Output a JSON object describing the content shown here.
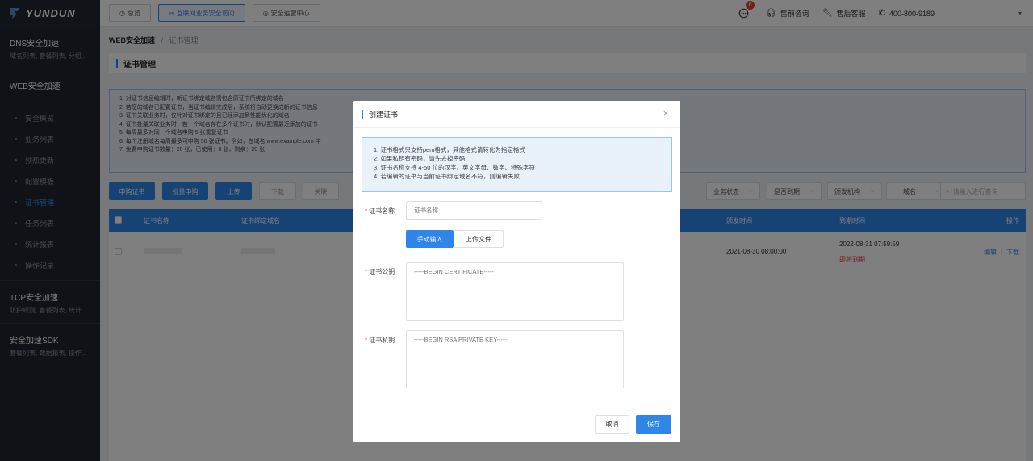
{
  "app": {
    "logo_text": "YUNDUN"
  },
  "topnav": {
    "tabs": [
      {
        "label": "总览"
      },
      {
        "label": "互联网业务安全访问"
      },
      {
        "label": "安全运营中心"
      }
    ],
    "notification_count": "6",
    "presales_label": "售前咨询",
    "aftersales_label": "售后客服",
    "phone": "400-800-9189"
  },
  "sidebar": {
    "groups": [
      {
        "title": "DNS安全加速",
        "subtitle": "域名列表, 套餐列表, 分组..."
      },
      {
        "title": "WEB安全加速"
      },
      {
        "title": "TCP安全加速",
        "subtitle": "防护规则, 套餐列表, 统计..."
      },
      {
        "title": "安全加速SDK",
        "subtitle": "套餐列表, 数据报表, 操作..."
      }
    ],
    "web_items": [
      {
        "label": "安全概览"
      },
      {
        "label": "业务列表"
      },
      {
        "label": "预热更新"
      },
      {
        "label": "配置模板"
      },
      {
        "label": "证书管理"
      },
      {
        "label": "任务列表"
      },
      {
        "label": "统计报表"
      },
      {
        "label": "操作记录"
      }
    ]
  },
  "breadcrumb": {
    "parent": "WEB安全加速",
    "separator": "/",
    "current": "证书管理"
  },
  "page": {
    "title": "证书管理",
    "notice_lines": [
      "1. 对证书信息编辑时，新证书绑定域名需包含原证书所绑定的域名",
      "2. 若您的域名已配置证书，当证书编辑完成后，系统将自动更换成新的证书信息",
      "3. 证书关联业务时，仅针对证书绑定的且已经添加到性能优化的域名",
      "4. 证书批量关联业务时，若一个域名存在多个证书时，默认配置最近添加的证书",
      "5. 每周最多对同一个域名申购 5 张重复证书",
      "6. 每个注册域名每周最多可申购 50 张证书。例如，在域名 www.example.com 中",
      "7. 免费申购证书数量：20 张，已使用：0 张，剩余：20 张"
    ]
  },
  "toolbar": {
    "apply_label": "申购证书",
    "batch_apply_label": "批量申购",
    "upload_label": "上传",
    "download_label": "下载",
    "associate_label": "关联",
    "filters": {
      "biz_status": "业务状态",
      "expired": "是否到期",
      "issuer": "颁发机构",
      "domain": "域名"
    },
    "search_placeholder": "请输入进行查询"
  },
  "table": {
    "columns": {
      "name": "证书名称",
      "domains": "证书绑定域名",
      "issued_at": "颁发时间",
      "expires_at": "到期时间",
      "actions": "操作"
    },
    "rows": [
      {
        "issued_at": "2021-08-30 08:00:00",
        "expires_at": "2022-08-31 07:59:59",
        "status": "即将到期",
        "edit_label": "编辑",
        "download_label": "下载"
      }
    ]
  },
  "modal": {
    "title": "创建证书",
    "notice_lines": [
      "1. 证书格式只支持pem格式，其他格式请转化为指定格式",
      "2. 如果私钥有密码，请先去掉密码",
      "3. 证书名称支持 4-50 位的汉字、英文字母、数字、特殊字符",
      "4. 若编辑的证书与当前证书绑定域名不符，则编辑失败"
    ],
    "name_label": "证书名称",
    "name_placeholder": "证书名称",
    "manual_label": "手动输入",
    "upload_file_label": "上传文件",
    "pubkey_label": "证书公钥",
    "pubkey_placeholder": "-----BEGIN CERTIFICATE-----",
    "privkey_label": "证书私钥",
    "privkey_placeholder": "-----BEGIN RSA PRIVATE KEY-----",
    "cancel_label": "取消",
    "save_label": "保存"
  },
  "colors": {
    "accent": "#2f86e8",
    "sidebar_bg": "#1f252d",
    "danger": "#e83b3b",
    "overlay": "rgba(0,0,0,0.5)"
  }
}
